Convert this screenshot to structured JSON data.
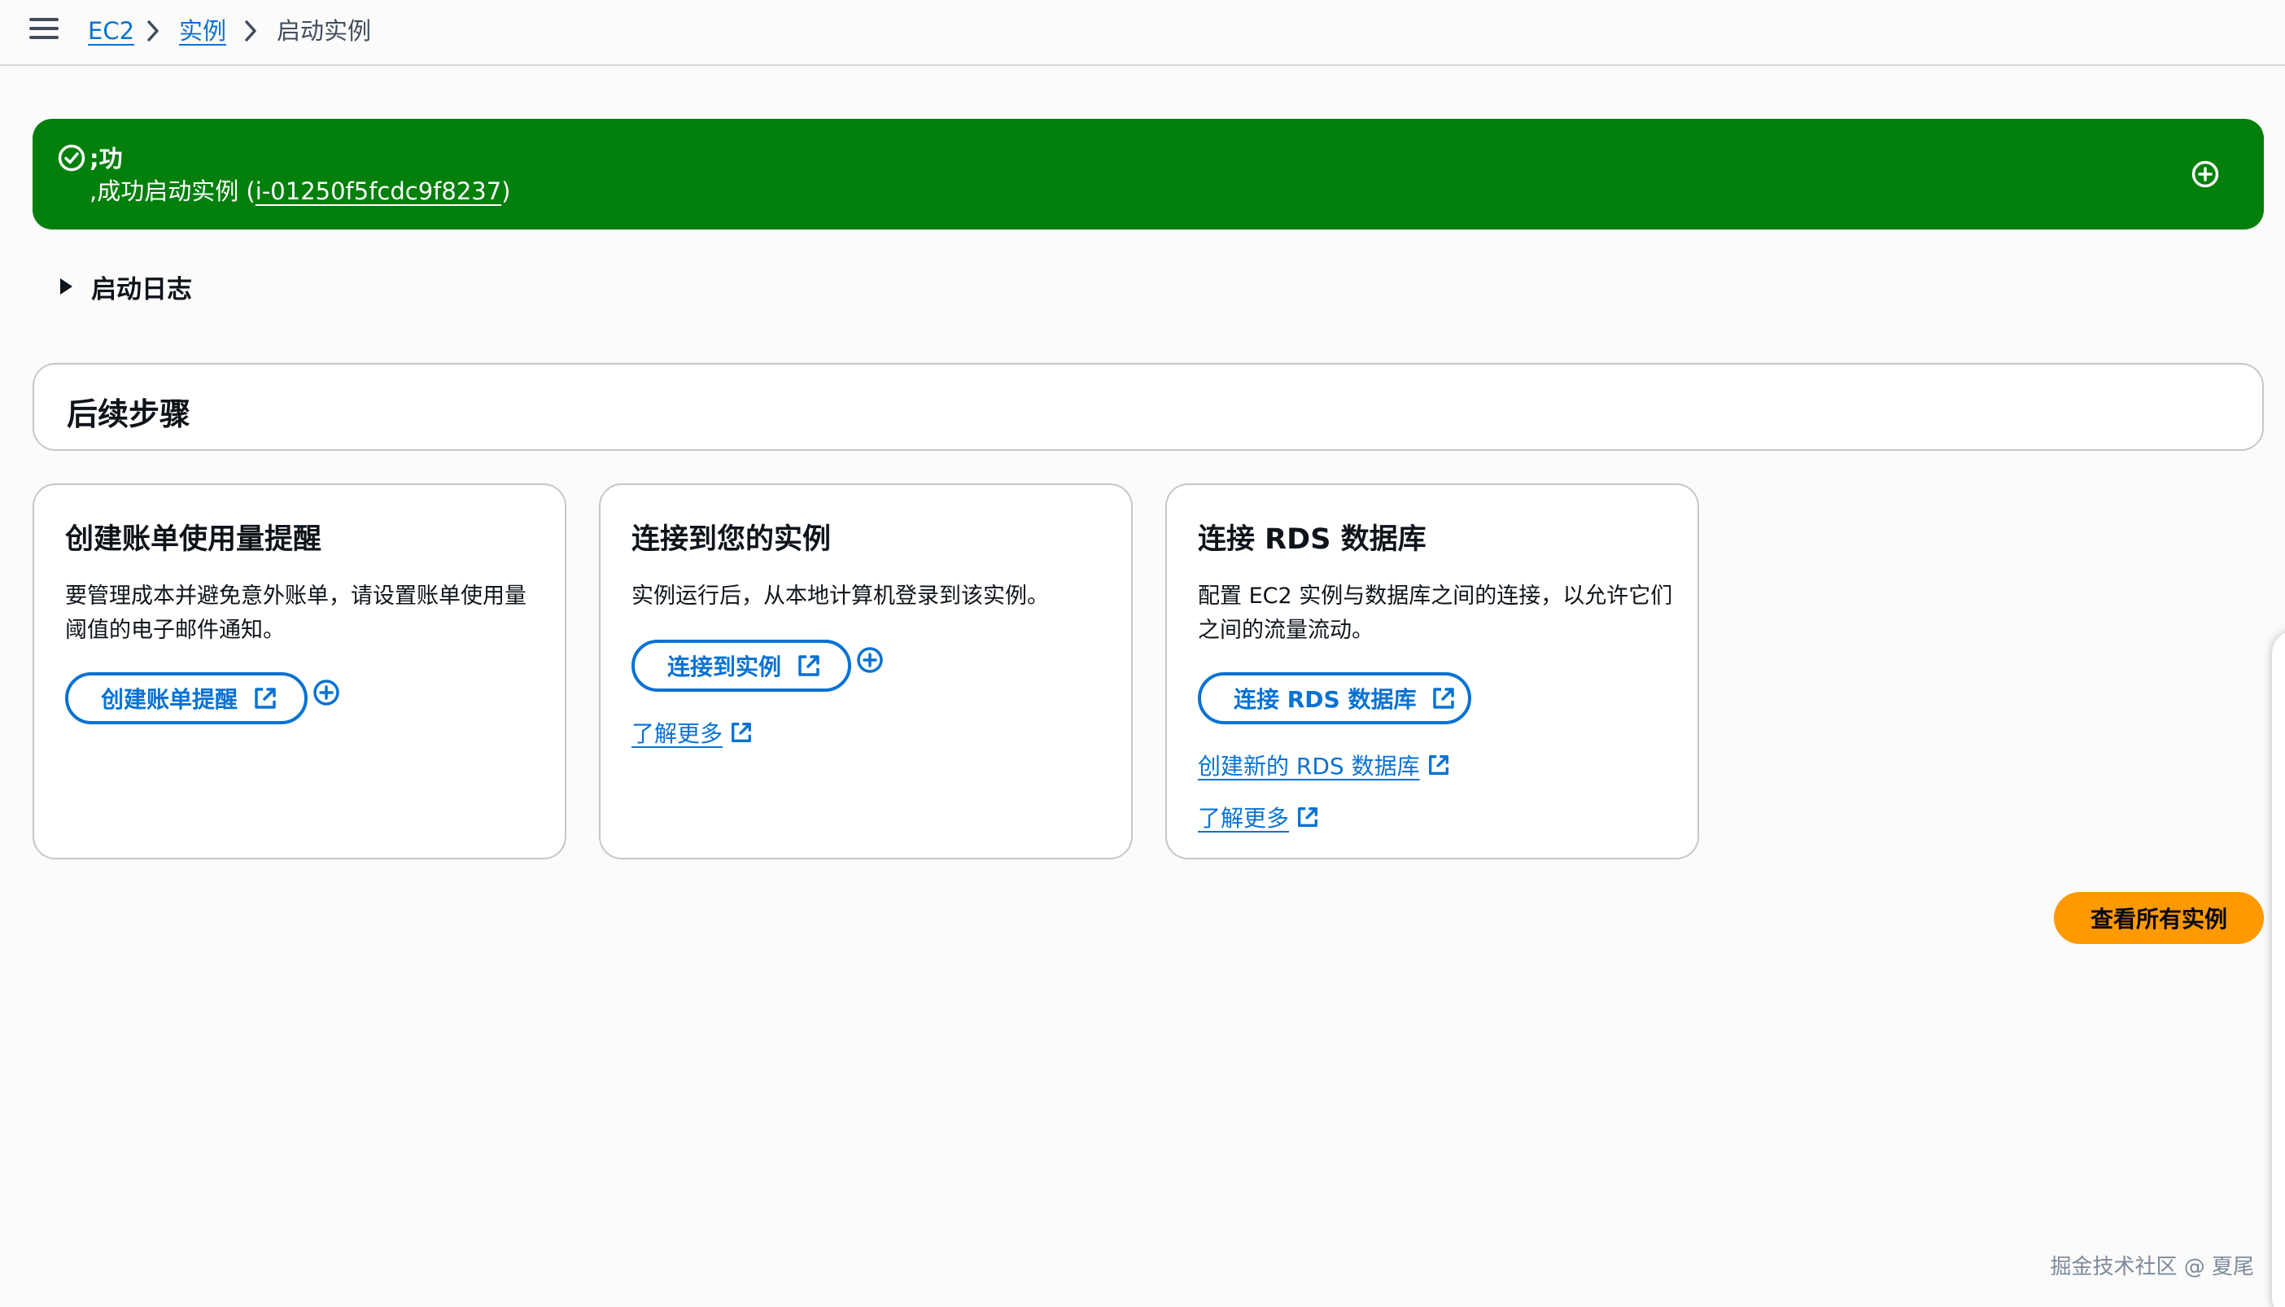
{
  "breadcrumb": {
    "items": [
      {
        "label": "EC2"
      },
      {
        "label": "实例"
      },
      {
        "label": "启动实例"
      }
    ]
  },
  "flash": {
    "title": ";功",
    "message_prefix": ",成功启动实例 (",
    "instance_id": "i-01250f5fcdc9f8237",
    "message_suffix": ")",
    "color": "#037f0c"
  },
  "launch_log": {
    "label": "启动日志"
  },
  "next_steps": {
    "title": "后续步骤"
  },
  "cards": [
    {
      "title": "创建账单使用量提醒",
      "description": "要管理成本并避免意外账单，请设置账单使用量阈值的电子邮件通知。",
      "button_label": "创建账单提醒"
    },
    {
      "title": "连接到您的实例",
      "description": "实例运行后，从本地计算机登录到该实例。",
      "button_label": "连接到实例",
      "link_label": "了解更多"
    },
    {
      "title": "连接 RDS 数据库",
      "description": "配置 EC2 实例与数据库之间的连接，以允许它们之间的流量流动。",
      "button_label": "连接 RDS 数据库",
      "link1_label": "创建新的 RDS 数据库",
      "link2_label": "了解更多"
    }
  ],
  "primary_button": {
    "label": "查看所有实例",
    "color": "#ff9900"
  },
  "watermark": "掘金技术社区 @ 夏尾",
  "icons": [
    "menu-icon",
    "chevron-right-icon",
    "check-circle-icon",
    "plus-circle-icon",
    "external-link-icon",
    "caret-right-icon"
  ],
  "accent_color": "#0972d3"
}
